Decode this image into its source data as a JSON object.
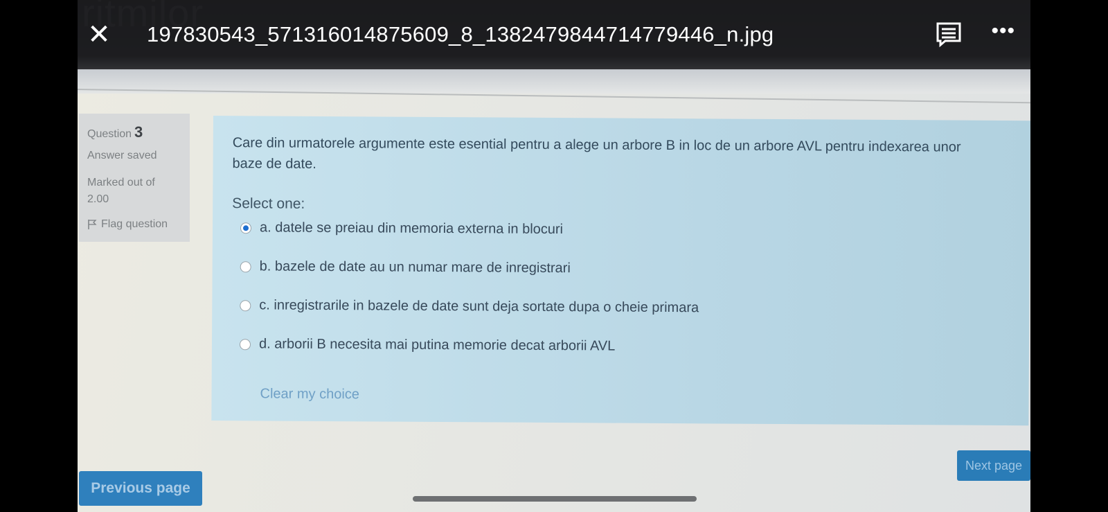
{
  "viewer": {
    "file_name": "197830543_571316014875609_8_1382479844714779446_n.jpg",
    "icons": {
      "close": "close-icon",
      "comment": "comment-icon",
      "more": "more-icon"
    },
    "more_glyph": "•••"
  },
  "photo": {
    "watermark": "ritmilor"
  },
  "quiz_info": {
    "question_label": "Question",
    "question_number": "3",
    "status": "Answer saved",
    "marked_label": "Marked out of",
    "marked_value": "2.00",
    "flag_label": "Flag question"
  },
  "question": {
    "text": "Care din urmatorele argumente este esential pentru a alege un arbore B in loc de un arbore AVL pentru indexarea unor baze de date.",
    "prompt": "Select one:",
    "options": [
      {
        "label": "a. datele se preiau din memoria externa in blocuri",
        "selected": true
      },
      {
        "label": "b. bazele de date au un numar mare de inregistrari",
        "selected": false
      },
      {
        "label": "c. inregistrarile in bazele de date sunt deja sortate dupa o cheie primara",
        "selected": false
      },
      {
        "label": "d. arborii B necesita mai putina memorie decat arborii AVL",
        "selected": false
      }
    ],
    "clear_label": "Clear my choice"
  },
  "navigation": {
    "next_label": "Next page",
    "previous_label": "Previous page"
  },
  "colors": {
    "panel": "#bfdde9",
    "primary_button": "#2a7cb7",
    "selected_radio": "#1e6fcf"
  }
}
